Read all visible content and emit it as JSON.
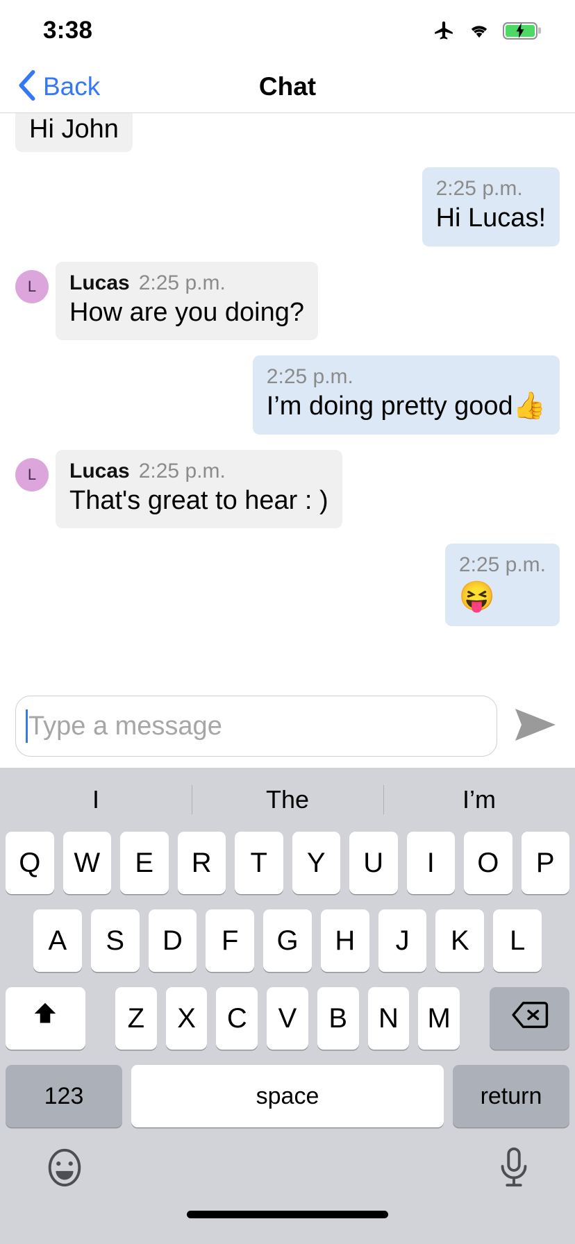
{
  "status_bar": {
    "time": "3:38",
    "icons": [
      "airplane-mode-icon",
      "wifi-icon",
      "battery-charging-icon"
    ]
  },
  "nav_bar": {
    "back_label": "Back",
    "back_icon": "chevron-left-icon",
    "title": "Chat",
    "accent_color": "#3478f6"
  },
  "conversation": {
    "messages": [
      {
        "direction": "incoming",
        "sender": "",
        "time": "",
        "text": "Hi John",
        "clipped": true,
        "avatar": ""
      },
      {
        "direction": "outgoing",
        "sender": "",
        "time": "2:25 p.m.",
        "text": "Hi Lucas!",
        "avatar": ""
      },
      {
        "direction": "incoming",
        "sender": "Lucas",
        "time": "2:25 p.m.",
        "text": "How are you doing?",
        "avatar": "L"
      },
      {
        "direction": "outgoing",
        "sender": "",
        "time": "2:25 p.m.",
        "text": "I’m doing pretty good👍",
        "avatar": ""
      },
      {
        "direction": "incoming",
        "sender": "Lucas",
        "time": "2:25 p.m.",
        "text": "That's great to hear : )",
        "avatar": "L"
      },
      {
        "direction": "outgoing",
        "sender": "",
        "time": "2:25 p.m.",
        "text": "😝",
        "avatar": ""
      }
    ],
    "incoming_bubble_color": "#f0f0f0",
    "outgoing_bubble_color": "#dce8f5",
    "avatar_color": "#dca5dc"
  },
  "composer": {
    "placeholder": "Type a message",
    "value": "",
    "send_icon": "send-arrow-icon",
    "caret_color": "#3478f6"
  },
  "keyboard": {
    "background_color": "#d1d3d9",
    "predictions": [
      "I",
      "The",
      "I’m"
    ],
    "row1": [
      "Q",
      "W",
      "E",
      "R",
      "T",
      "Y",
      "U",
      "I",
      "O",
      "P"
    ],
    "row2": [
      "A",
      "S",
      "D",
      "F",
      "G",
      "H",
      "J",
      "K",
      "L"
    ],
    "row3": [
      "Z",
      "X",
      "C",
      "V",
      "B",
      "N",
      "M"
    ],
    "shift_icon": "shift-arrow-icon",
    "backspace_icon": "backspace-icon",
    "numbers_label": "123",
    "space_label": "space",
    "return_label": "return",
    "emoji_icon": "emoji-smiley-icon",
    "dictation_icon": "microphone-icon"
  }
}
